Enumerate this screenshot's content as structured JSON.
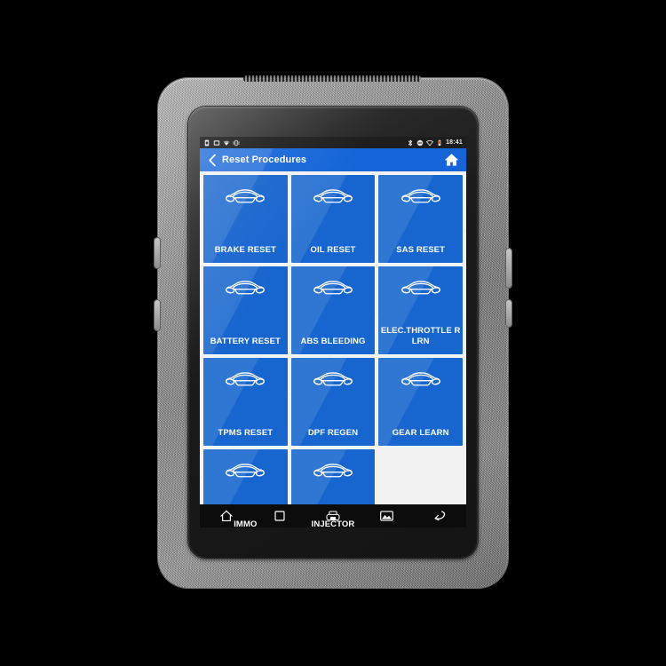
{
  "device": {
    "name": "automotive-diagnostic-tablet"
  },
  "colors": {
    "accent_blue": "#1765ce",
    "titlebar_blue": "#1565d8",
    "screen_bg": "#f2f2f2",
    "statusbar_bg": "#1d1d1d",
    "navbar_bg": "#0c0c0c",
    "tile_text": "#ffffff"
  },
  "statusbar": {
    "left_icons": [
      "sim-card-icon",
      "sd-card-icon",
      "wifi-signal-icon",
      "vibrate-icon"
    ],
    "right_icons": [
      "bluetooth-icon",
      "dnd-icon",
      "wifi-icon",
      "battery-icon"
    ],
    "clock": "18:41"
  },
  "titlebar": {
    "back_icon": "chevron-left-icon",
    "title": "Reset Procedures",
    "home_icon": "home-icon"
  },
  "grid": {
    "icon_name": "car-front-icon",
    "tiles": [
      {
        "id": "brake-reset",
        "label": "BRAKE RESET"
      },
      {
        "id": "oil-reset",
        "label": "OIL RESET"
      },
      {
        "id": "sas-reset",
        "label": "SAS RESET"
      },
      {
        "id": "battery-reset",
        "label": "BATTERY RESET"
      },
      {
        "id": "abs-bleeding",
        "label": "ABS BLEEDING"
      },
      {
        "id": "elec-throttle-rlrn",
        "label": "ELEC.THROTTLE RLRN"
      },
      {
        "id": "tpms-reset",
        "label": "TPMS RESET"
      },
      {
        "id": "dpf-regen",
        "label": "DPF REGEN"
      },
      {
        "id": "gear-learn",
        "label": "GEAR LEARN"
      },
      {
        "id": "immo",
        "label": "IMMO"
      },
      {
        "id": "injector",
        "label": "INJECTOR"
      }
    ]
  },
  "navbar": {
    "buttons": [
      {
        "id": "nav-home",
        "icon": "home-icon"
      },
      {
        "id": "nav-recents",
        "icon": "square-icon"
      },
      {
        "id": "nav-print",
        "icon": "printer-icon"
      },
      {
        "id": "nav-gallery",
        "icon": "image-icon"
      },
      {
        "id": "nav-back",
        "icon": "back-arrow-icon"
      }
    ]
  }
}
